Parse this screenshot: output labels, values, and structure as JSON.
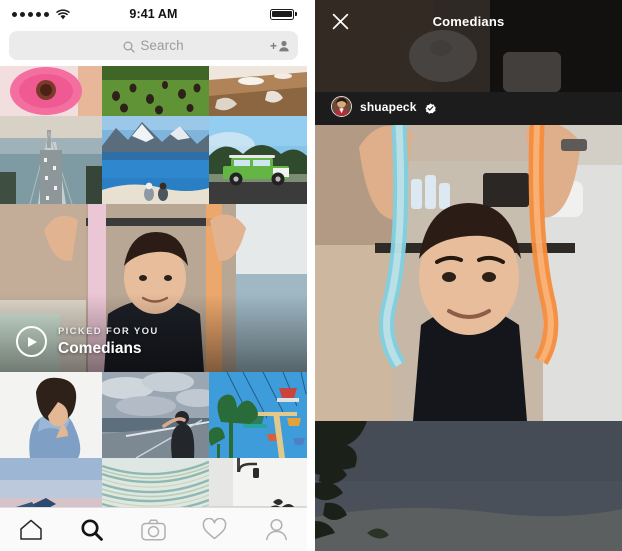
{
  "left_screen": {
    "name": "explore-screen",
    "statusbar": {
      "time": "9:41 AM",
      "signal_icon": "signal-dots-icon",
      "wifi_icon": "wifi-icon",
      "battery_icon": "battery-full-icon"
    },
    "search": {
      "placeholder": "Search",
      "search_icon": "search-icon",
      "add_person_icon": "add-person-icon",
      "add_person_plus": "+"
    },
    "featured": {
      "kicker": "PICKED FOR YOU",
      "title": "Comedians",
      "play_icon": "play-circle-icon"
    },
    "grid": {
      "row1": [
        {
          "alt": "pink-flower-macro"
        },
        {
          "alt": "park-lawn-crowd"
        },
        {
          "alt": "wooden-table-chairs"
        }
      ],
      "row2": [
        {
          "alt": "bay-bridge-traffic"
        },
        {
          "alt": "snowy-mountain-lake"
        },
        {
          "alt": "couple-sitting-lakeshore"
        },
        {
          "alt": "green-vintage-suv"
        }
      ],
      "row3": [
        {
          "alt": "woman-denim-jacket"
        },
        {
          "alt": "person-pier-clouds"
        },
        {
          "alt": "amusement-park-swings"
        }
      ],
      "row4": [
        {
          "alt": "airplane-wing-sunset"
        },
        {
          "alt": "agave-palm-leaves"
        },
        {
          "alt": "white-shelf-lamp"
        }
      ]
    },
    "tabbar": {
      "items": [
        {
          "name": "home-icon",
          "label": "Home",
          "active": false
        },
        {
          "name": "search-icon",
          "label": "Search",
          "active": true
        },
        {
          "name": "camera-icon",
          "label": "Camera",
          "active": false
        },
        {
          "name": "heart-icon",
          "label": "Activity",
          "active": false
        },
        {
          "name": "profile-icon",
          "label": "Profile",
          "active": false
        }
      ]
    }
  },
  "right_screen": {
    "name": "story-viewer-screen",
    "header": {
      "title": "Comedians",
      "close_icon": "close-x-icon"
    },
    "user": {
      "username": "shuapeck",
      "verified_icon": "verified-badge-icon",
      "avatar_alt": "shuapeck-avatar"
    },
    "media": {
      "top_alt": "dim-shoe-preview",
      "main_alt": "man-holding-pool-noodles",
      "bottom_alt": "dusk-tree-silhouette"
    }
  },
  "colors": {
    "background": "#ffffff",
    "search_field": "#ebebeb",
    "placeholder_text": "#9b9b9b",
    "tabbar_bg": "#fafafa",
    "tabbar_border": "#dddddd",
    "icon_inactive": "#262626",
    "story_bg": "#1c1c1c",
    "story_bottom": "#474d55",
    "text_dark": "#111111",
    "text_white": "#ffffff",
    "verified_blue": "#ffffff"
  }
}
